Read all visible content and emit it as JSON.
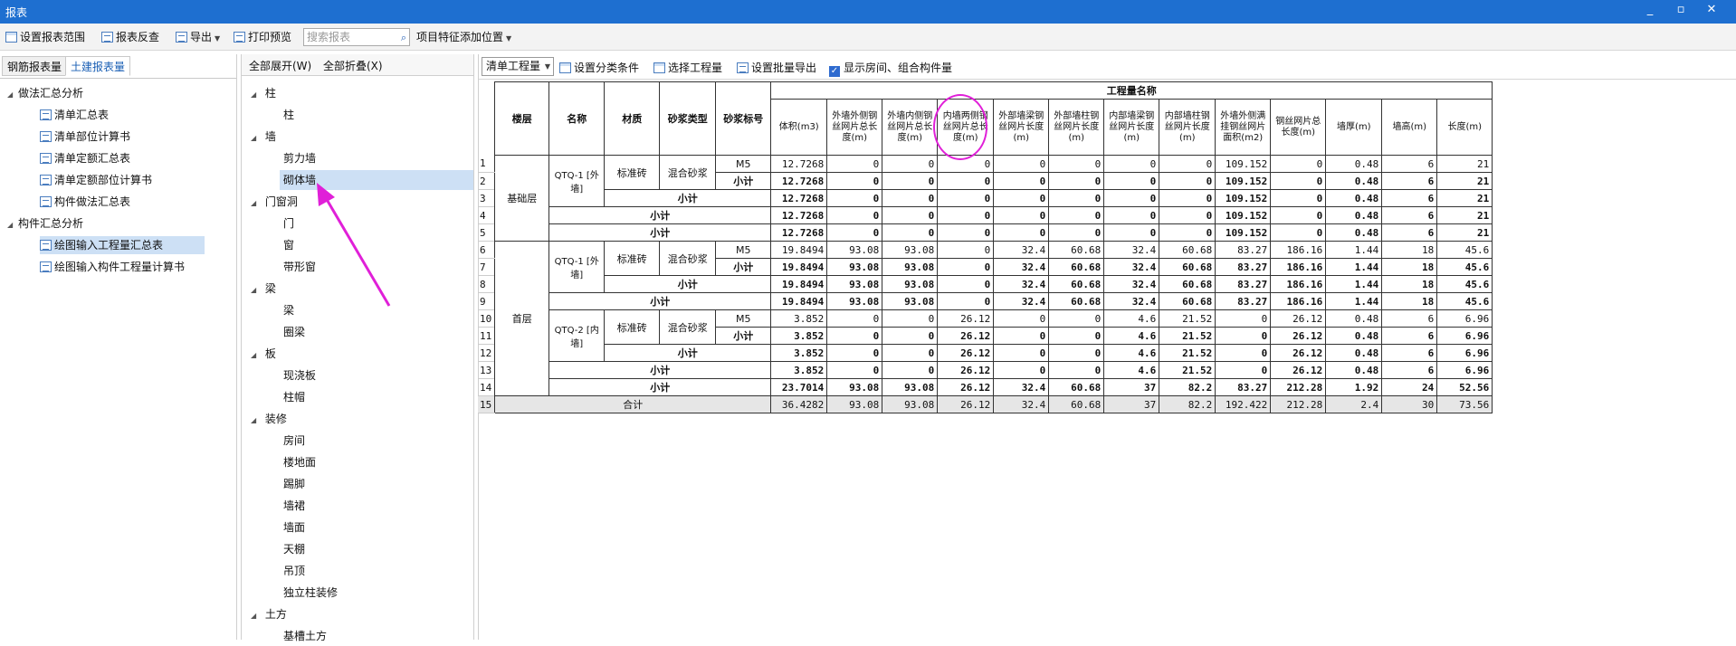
{
  "window": {
    "title": "报表",
    "controls": [
      "_",
      "▫",
      "✕"
    ]
  },
  "toolbar": {
    "set_range": "设置报表范围",
    "reverse_check": "报表反查",
    "export": "导出",
    "print_preview": "打印预览",
    "search_placeholder": "搜索报表",
    "add_position": "项目特征添加位置"
  },
  "left": {
    "tabs": [
      "钢筋报表量",
      "土建报表量"
    ],
    "active_tab": 1,
    "tree": [
      {
        "group": "做法汇总分析",
        "items": [
          "清单汇总表",
          "清单部位计算书",
          "清单定额汇总表",
          "清单定额部位计算书",
          "构件做法汇总表"
        ]
      },
      {
        "group": "构件汇总分析",
        "items": [
          "绘图输入工程量汇总表",
          "绘图输入构件工程量计算书"
        ]
      }
    ],
    "selected": "绘图输入工程量汇总表"
  },
  "middle": {
    "expand_all": "全部展开(W)",
    "collapse_all": "全部折叠(X)",
    "groups": [
      {
        "name": "柱",
        "items": [
          "柱"
        ]
      },
      {
        "name": "墙",
        "items": [
          "剪力墙",
          "砌体墙"
        ]
      },
      {
        "name": "门窗洞",
        "items": [
          "门",
          "窗",
          "带形窗"
        ]
      },
      {
        "name": "梁",
        "items": [
          "梁",
          "圈梁"
        ]
      },
      {
        "name": "板",
        "items": [
          "现浇板",
          "柱帽"
        ]
      },
      {
        "name": "装修",
        "items": [
          "房间",
          "楼地面",
          "踢脚",
          "墙裙",
          "墙面",
          "天棚",
          "吊顶",
          "独立柱装修"
        ]
      },
      {
        "name": "土方",
        "items": [
          "基槽土方"
        ]
      }
    ],
    "selected": "砌体墙"
  },
  "right": {
    "combo": "清单工程量",
    "set_category": "设置分类条件",
    "choose_qty": "选择工程量",
    "batch_export": "设置批量导出",
    "show_rooms": "显示房间、组合构件量"
  },
  "table": {
    "h_floor": "楼层",
    "h_name": "名称",
    "h_material": "材质",
    "h_mortar_type": "砂浆类型",
    "h_mortar_grade": "砂浆标号",
    "h_group": "工程量名称",
    "columns": [
      "体积(m3)",
      "外墙外侧钢丝网片总长度(m)",
      "外墙内侧钢丝网片总长度(m)",
      "内墙两侧钢丝网片总长度(m)",
      "外部墙梁钢丝网片长度(m)",
      "外部墙柱钢丝网片长度(m)",
      "内部墙梁钢丝网片长度(m)",
      "内部墙柱钢丝网片长度(m)",
      "外墙外侧满挂钢丝网片面积(m2)",
      "钢丝网片总长度(m)",
      "墙厚(m)",
      "墙高(m)",
      "长度(m)"
    ],
    "floor1": "基础层",
    "floor2": "首层",
    "name1": "QTQ-1 [外墙]",
    "name2": "QTQ-1 [外墙]",
    "name3": "QTQ-2 [内墙]",
    "brick": "标准砖",
    "mortar": "混合砂浆",
    "m5": "M5",
    "subtotal": "小计",
    "total": "合计",
    "rows": [
      [
        "12.7268",
        "0",
        "0",
        "0",
        "0",
        "0",
        "0",
        "0",
        "109.152",
        "0",
        "0.48",
        "6",
        "21"
      ],
      [
        "12.7268",
        "0",
        "0",
        "0",
        "0",
        "0",
        "0",
        "0",
        "109.152",
        "0",
        "0.48",
        "6",
        "21"
      ],
      [
        "12.7268",
        "0",
        "0",
        "0",
        "0",
        "0",
        "0",
        "0",
        "109.152",
        "0",
        "0.48",
        "6",
        "21"
      ],
      [
        "12.7268",
        "0",
        "0",
        "0",
        "0",
        "0",
        "0",
        "0",
        "109.152",
        "0",
        "0.48",
        "6",
        "21"
      ],
      [
        "12.7268",
        "0",
        "0",
        "0",
        "0",
        "0",
        "0",
        "0",
        "109.152",
        "0",
        "0.48",
        "6",
        "21"
      ],
      [
        "19.8494",
        "93.08",
        "93.08",
        "0",
        "32.4",
        "60.68",
        "32.4",
        "60.68",
        "83.27",
        "186.16",
        "1.44",
        "18",
        "45.6"
      ],
      [
        "19.8494",
        "93.08",
        "93.08",
        "0",
        "32.4",
        "60.68",
        "32.4",
        "60.68",
        "83.27",
        "186.16",
        "1.44",
        "18",
        "45.6"
      ],
      [
        "19.8494",
        "93.08",
        "93.08",
        "0",
        "32.4",
        "60.68",
        "32.4",
        "60.68",
        "83.27",
        "186.16",
        "1.44",
        "18",
        "45.6"
      ],
      [
        "19.8494",
        "93.08",
        "93.08",
        "0",
        "32.4",
        "60.68",
        "32.4",
        "60.68",
        "83.27",
        "186.16",
        "1.44",
        "18",
        "45.6"
      ],
      [
        "3.852",
        "0",
        "0",
        "26.12",
        "0",
        "0",
        "4.6",
        "21.52",
        "0",
        "26.12",
        "0.48",
        "6",
        "6.96"
      ],
      [
        "3.852",
        "0",
        "0",
        "26.12",
        "0",
        "0",
        "4.6",
        "21.52",
        "0",
        "26.12",
        "0.48",
        "6",
        "6.96"
      ],
      [
        "3.852",
        "0",
        "0",
        "26.12",
        "0",
        "0",
        "4.6",
        "21.52",
        "0",
        "26.12",
        "0.48",
        "6",
        "6.96"
      ],
      [
        "3.852",
        "0",
        "0",
        "26.12",
        "0",
        "0",
        "4.6",
        "21.52",
        "0",
        "26.12",
        "0.48",
        "6",
        "6.96"
      ],
      [
        "23.7014",
        "93.08",
        "93.08",
        "26.12",
        "32.4",
        "60.68",
        "37",
        "82.2",
        "83.27",
        "212.28",
        "1.92",
        "24",
        "52.56"
      ],
      [
        "36.4282",
        "93.08",
        "93.08",
        "26.12",
        "32.4",
        "60.68",
        "37",
        "82.2",
        "192.422",
        "212.28",
        "2.4",
        "30",
        "73.56"
      ]
    ]
  }
}
